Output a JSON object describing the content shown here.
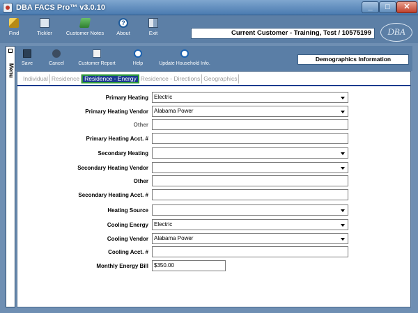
{
  "window": {
    "title": "DBA FACS Pro™ v3.0.10",
    "min": "_",
    "max": "□",
    "close": "✕"
  },
  "toolbar": [
    {
      "label": "Find",
      "icon": "find-icon"
    },
    {
      "label": "Tickler",
      "icon": "tickler-icon"
    },
    {
      "label": "Customer Notes",
      "icon": "notes-icon"
    },
    {
      "label": "About",
      "icon": "help-icon"
    },
    {
      "label": "Exit",
      "icon": "exit-icon"
    }
  ],
  "current_customer": "Current Customer - Training, Test / 10575199",
  "logo_text": "DBA",
  "side_menu": {
    "label": "Menu"
  },
  "subtoolbar": [
    {
      "label": "Save"
    },
    {
      "label": "Cancel"
    },
    {
      "label": "Customer Report"
    },
    {
      "label": "Help"
    },
    {
      "label": "Update Household Info."
    }
  ],
  "section_title": "Demographics Information",
  "tabs": [
    "Individual",
    "Residence",
    "Residence - Energy",
    "Residence - Directions",
    "Geographics"
  ],
  "active_tab": "Residence - Energy",
  "form": [
    {
      "label": "Primary Heating",
      "value": "Electric",
      "type": "dropdown"
    },
    {
      "label": "Primary Heating Vendor",
      "value": "Alabama Power",
      "type": "dropdown"
    },
    {
      "label": "Other",
      "value": "",
      "type": "text",
      "dim": true
    },
    {
      "label": "Primary Heating Acct. #",
      "value": "",
      "type": "text"
    },
    {
      "label": "Secondary Heating",
      "value": "",
      "type": "dropdown"
    },
    {
      "label": "Secondary Heating Vendor",
      "value": "",
      "type": "dropdown"
    },
    {
      "label": "Other",
      "value": "",
      "type": "text"
    },
    {
      "label": "Secondary Heating Acct. #",
      "value": "",
      "type": "text"
    },
    {
      "label": "Heating Source",
      "value": "",
      "type": "dropdown"
    },
    {
      "label": "Cooling Energy",
      "value": "Electric",
      "type": "dropdown"
    },
    {
      "label": "Cooling Vendor",
      "value": "Alabama Power",
      "type": "dropdown"
    },
    {
      "label": "Cooling Acct. #",
      "value": "",
      "type": "text"
    },
    {
      "label": "Monthly Energy Bill",
      "value": "$350.00",
      "type": "text",
      "short": true
    }
  ]
}
